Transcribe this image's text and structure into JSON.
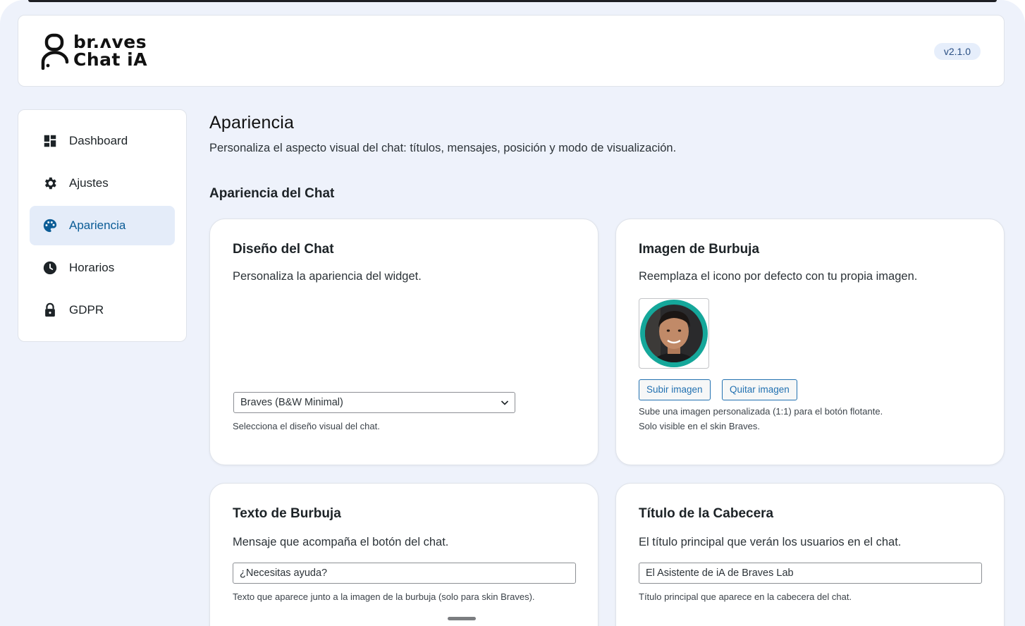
{
  "app": {
    "logo_line1": "br.ʌves",
    "logo_line2": "Chat iA",
    "version": "v2.1.0"
  },
  "sidebar": {
    "items": [
      {
        "label": "Dashboard",
        "icon": "dashboard-icon"
      },
      {
        "label": "Ajustes",
        "icon": "gear-icon"
      },
      {
        "label": "Apariencia",
        "icon": "palette-icon",
        "active": true
      },
      {
        "label": "Horarios",
        "icon": "clock-icon"
      },
      {
        "label": "GDPR",
        "icon": "lock-icon"
      }
    ]
  },
  "page": {
    "title": "Apariencia",
    "description": "Personaliza el aspecto visual del chat: títulos, mensajes, posición y modo de visualización.",
    "section_title": "Apariencia del Chat"
  },
  "cards": {
    "design": {
      "title": "Diseño del Chat",
      "description": "Personaliza la apariencia del widget.",
      "select_value": "Braves (B&W Minimal)",
      "hint": "Selecciona el diseño visual del chat."
    },
    "bubble_image": {
      "title": "Imagen de Burbuja",
      "description": "Reemplaza el icono por defecto con tu propia imagen.",
      "upload_label": "Subir imagen",
      "remove_label": "Quitar imagen",
      "hint_line1": "Sube una imagen personalizada (1:1) para el botón flotante.",
      "hint_line2": "Solo visible en el skin Braves."
    },
    "bubble_text": {
      "title": "Texto de Burbuja",
      "description": "Mensaje que acompaña el botón del chat.",
      "input_value": "¿Necesitas ayuda?",
      "hint": "Texto que aparece junto a la imagen de la burbuja (solo para skin Braves)."
    },
    "header_title": {
      "title": "Título de la Cabecera",
      "description": "El título principal que verán los usuarios en el chat.",
      "input_value": "El Asistente de iA de Braves Lab",
      "hint": "Título principal que aparece en la cabecera del chat."
    }
  },
  "colors": {
    "accent": "#0b5c96",
    "active_bg": "#e4ecf9",
    "page_bg": "#eef2fb",
    "avatar_ring": "#15a79a"
  }
}
